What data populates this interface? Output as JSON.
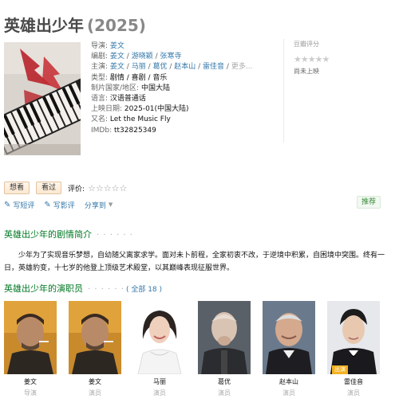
{
  "title": "英雄出少年",
  "year": "(2025)",
  "info": {
    "director_label": "导演:",
    "director": "姜文",
    "writers_label": "编剧:",
    "writers": [
      "姜文",
      "游晓颖",
      "张寒寺"
    ],
    "cast_label": "主演:",
    "cast": [
      "姜文",
      "马丽",
      "葛优",
      "赵本山",
      "雷佳音"
    ],
    "cast_more": "更多...",
    "genre_label": "类型:",
    "genre": "剧情 / 喜剧 / 音乐",
    "country_label": "制片国家/地区:",
    "country": "中国大陆",
    "language_label": "语言:",
    "language": "汉语普通话",
    "release_label": "上映日期:",
    "release": "2025-01(中国大陆)",
    "aka_label": "又名:",
    "aka": "Let the Music Fly",
    "imdb_label": "IMDb:",
    "imdb": "tt32825349"
  },
  "rating": {
    "label": "豆瓣评分",
    "stars": "★★★★★",
    "status": "尚未上映"
  },
  "actions": {
    "want": "想看",
    "seen": "看过",
    "eval_label": "评价:",
    "eval_stars": "☆☆☆☆☆"
  },
  "share": {
    "short_review": "写短评",
    "review": "写影评",
    "share": "分享到"
  },
  "recommend": "推荐",
  "synopsis": {
    "title": "英雄出少年的剧情简介",
    "dots": "· · · · · ·",
    "text": "少年为了实现音乐梦想，自幼随父离家求学。面对未卜前程，全家初衷不改，于逆境中积累，自困境中突围。终有一日，英雄豹变，十七岁的他登上顶级艺术殿堂，以其巅峰表现征服世界。"
  },
  "cast_section": {
    "title": "英雄出少年的演职员",
    "dots": "· · · · · ·",
    "all": "( 全部 18 )",
    "members": [
      {
        "name": "姜文",
        "role": "导演"
      },
      {
        "name": "姜文",
        "role": "演员"
      },
      {
        "name": "马丽",
        "role": "演员"
      },
      {
        "name": "葛优",
        "role": "演员"
      },
      {
        "name": "赵本山",
        "role": "演员"
      },
      {
        "name": "雷佳音",
        "role": "演员",
        "badge": "出演"
      }
    ]
  },
  "colors": {
    "link": "#3377aa",
    "section_title": "#007722",
    "badge": "#f4b223"
  }
}
